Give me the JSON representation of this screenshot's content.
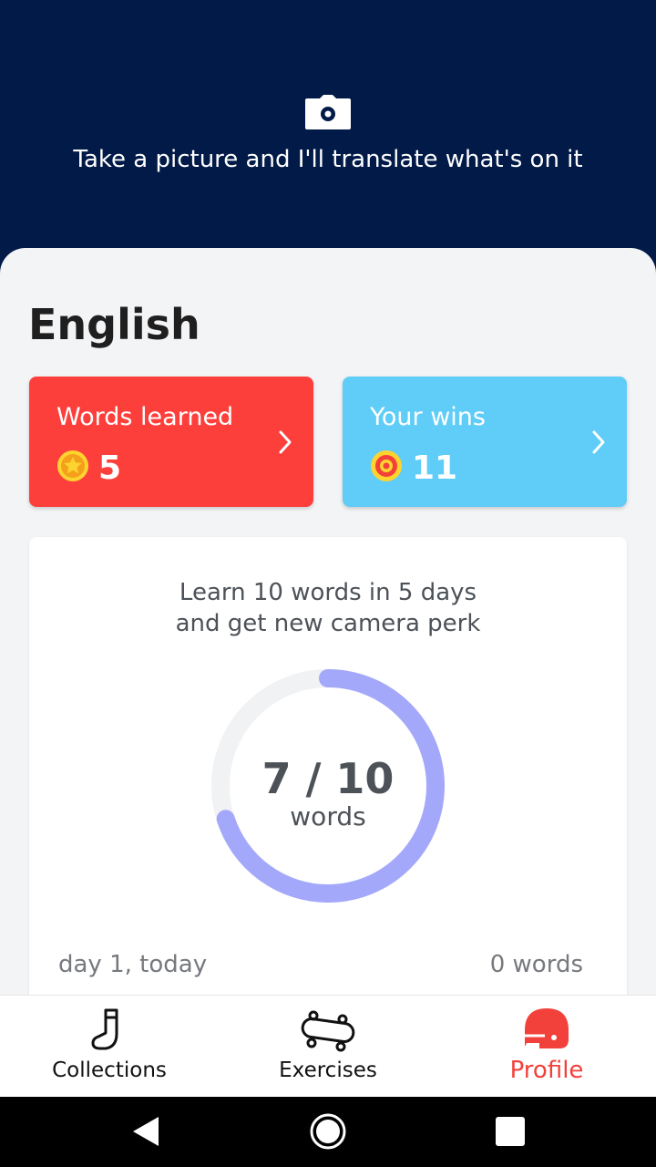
{
  "header": {
    "camera_icon": "camera-icon",
    "caption": "Take a picture and I'll translate what's on it"
  },
  "language": {
    "title": "English"
  },
  "stats": {
    "words_learned": {
      "label": "Words learned",
      "value": "5",
      "icon": "star-icon",
      "color": "#fd3f3c"
    },
    "wins": {
      "label": "Your wins",
      "value": "11",
      "icon": "target-icon",
      "color": "#5fcdf7"
    }
  },
  "goal": {
    "line1": "Learn 10 words in 5 days",
    "line2": "and get new camera perk",
    "progress_text": "7 / 10",
    "progress_unit": "words",
    "progress": {
      "current": 7,
      "total": 10
    },
    "ring_color": "#a3a8fa",
    "track_color": "#f1f2f4",
    "day_label": "day 1, today",
    "day_words": "0 words"
  },
  "tabs": [
    {
      "label": "Collections",
      "icon": "sock-icon",
      "active": false
    },
    {
      "label": "Exercises",
      "icon": "skateboard-icon",
      "active": false
    },
    {
      "label": "Profile",
      "icon": "helmet-icon",
      "active": true
    }
  ],
  "accent_color": "#f2413b",
  "system_nav": {
    "back": "back-icon",
    "home": "home-icon",
    "recents": "recents-icon"
  }
}
